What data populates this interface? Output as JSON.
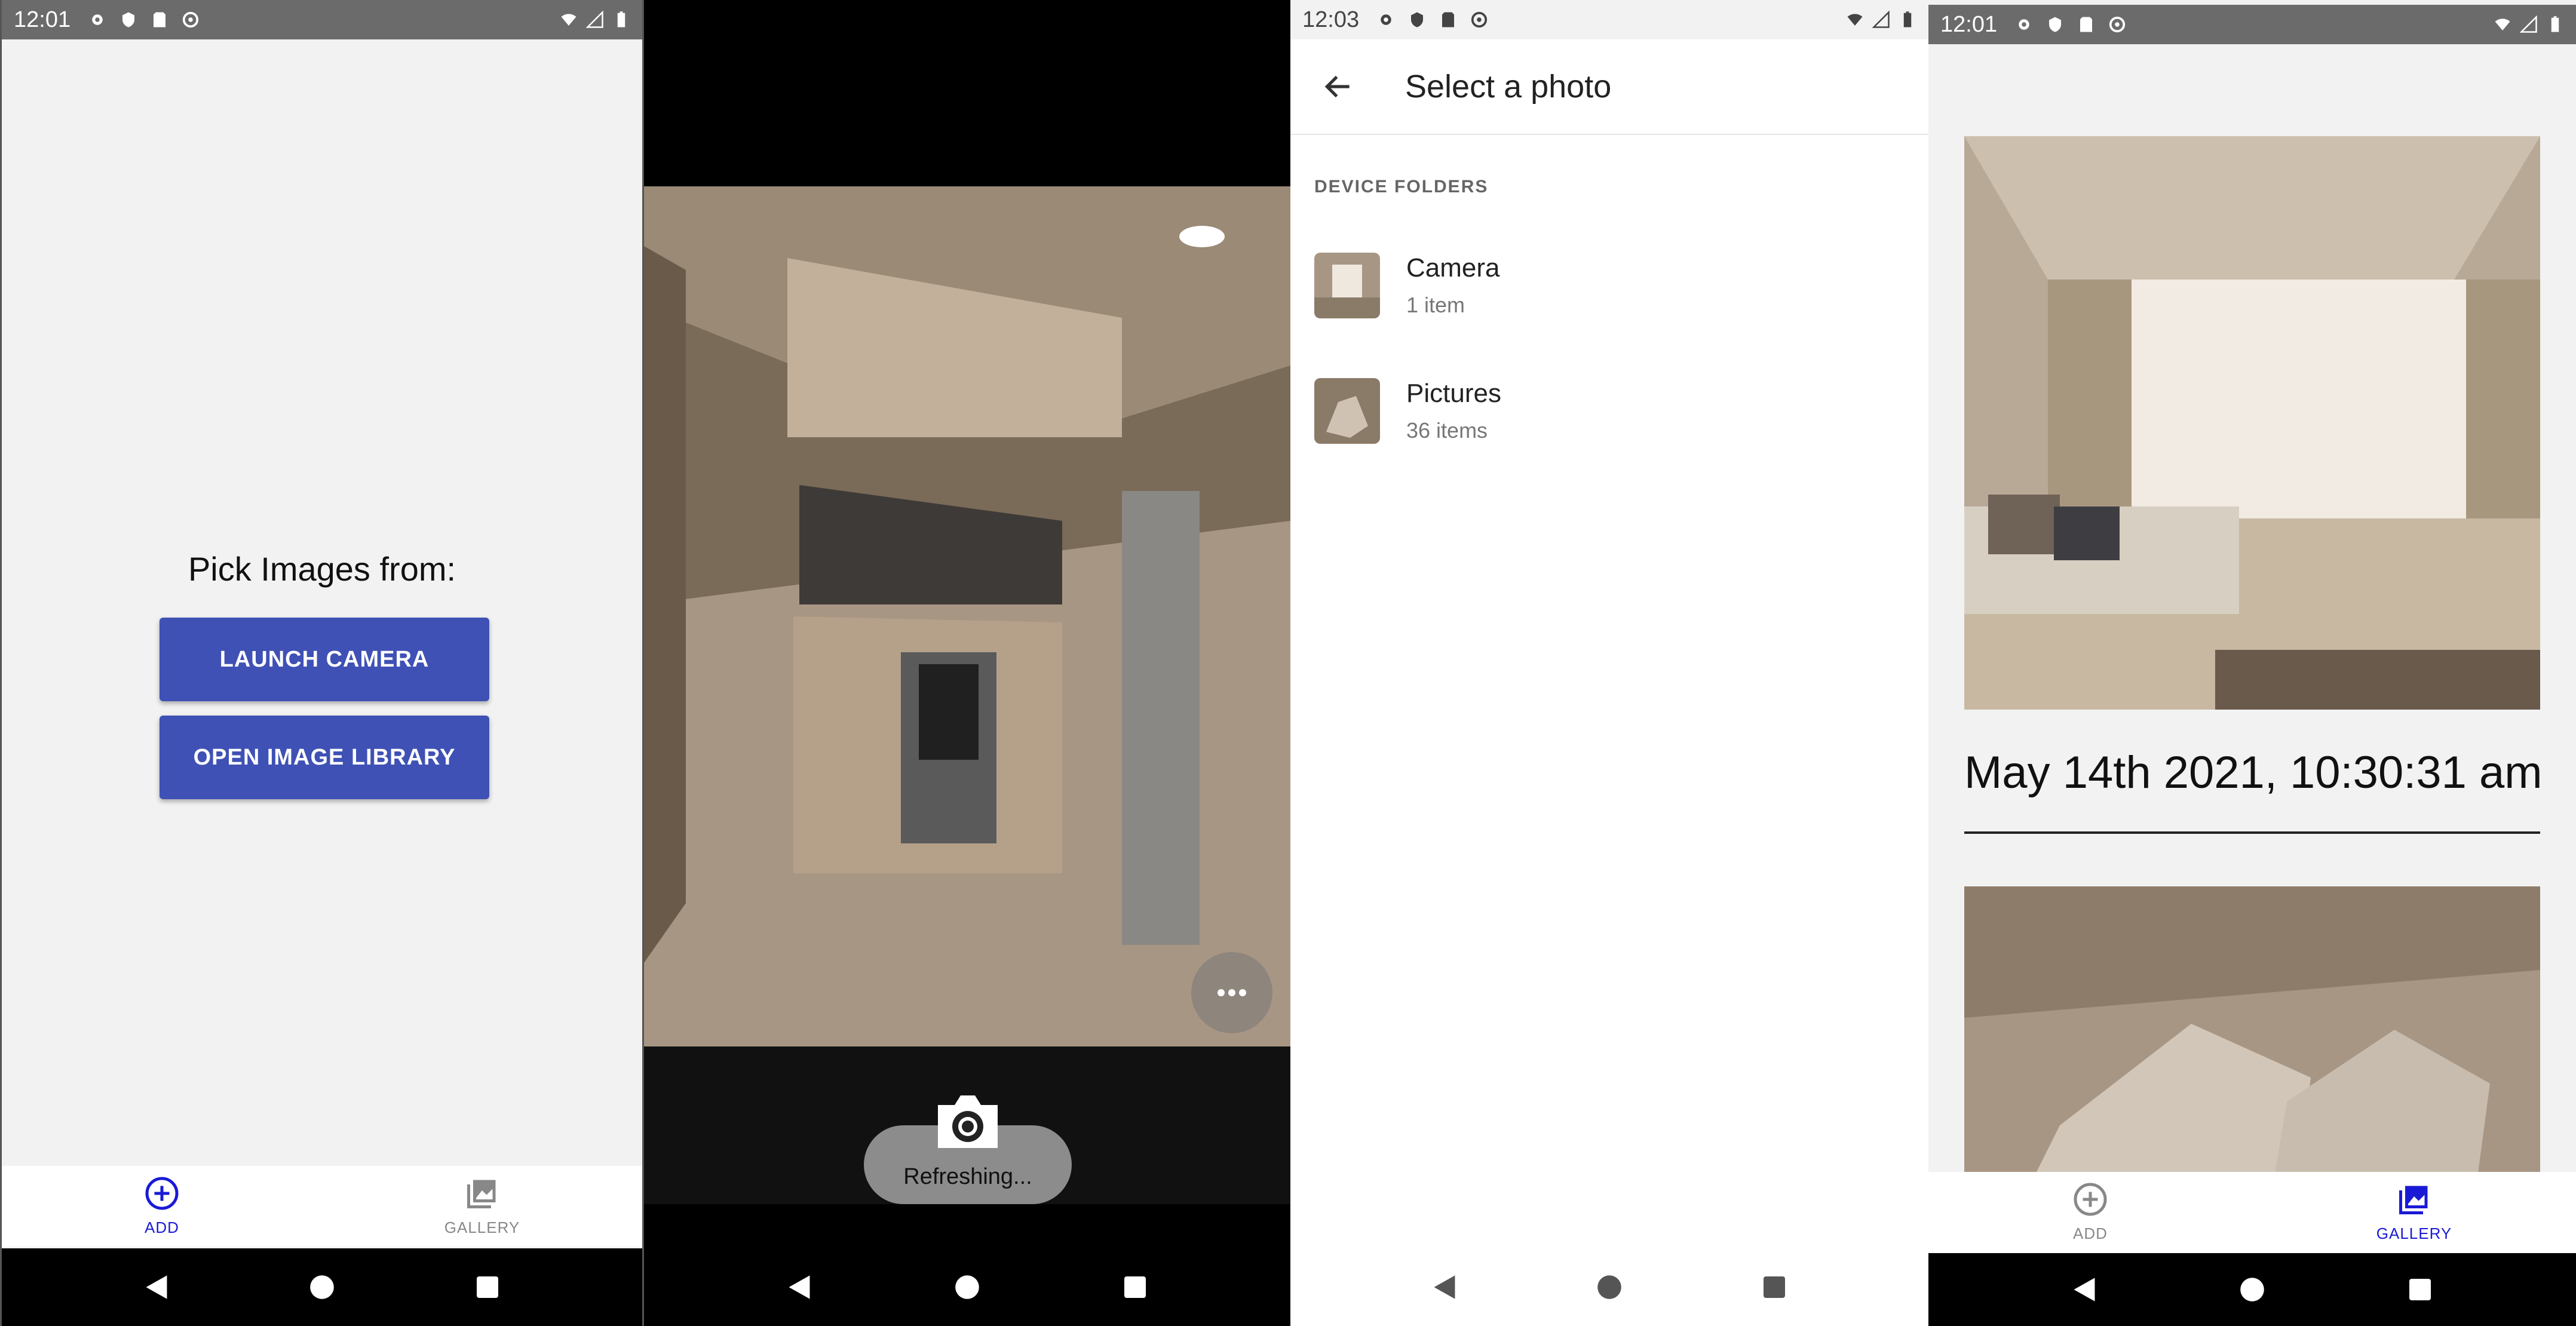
{
  "panel1": {
    "status": {
      "time": "12:01"
    },
    "heading": "Pick Images from:",
    "buttons": {
      "launch_camera": "LAUNCH CAMERA",
      "open_library": "OPEN IMAGE LIBRARY"
    },
    "tabs": [
      {
        "label": "ADD",
        "icon": "add-circle-icon"
      },
      {
        "label": "GALLERY",
        "icon": "gallery-icon"
      }
    ],
    "active_tab": "ADD"
  },
  "panel2": {
    "toast": "Refreshing..."
  },
  "panel3": {
    "status": {
      "time": "12:03"
    },
    "title": "Select a photo",
    "section": "DEVICE FOLDERS",
    "folders": [
      {
        "name": "Camera",
        "count": "1 item"
      },
      {
        "name": "Pictures",
        "count": "36 items"
      }
    ]
  },
  "panel4": {
    "status": {
      "time": "12:01"
    },
    "date_text": "May 14th 2021, 10:30:31 am",
    "tabs": [
      {
        "label": "ADD",
        "icon": "add-circle-icon"
      },
      {
        "label": "GALLERY",
        "icon": "gallery-icon"
      }
    ],
    "active_tab": "GALLERY"
  },
  "colors": {
    "primary": "#3f51b5",
    "active_tab": "#1a1ad6",
    "inactive_tab": "#888888"
  }
}
